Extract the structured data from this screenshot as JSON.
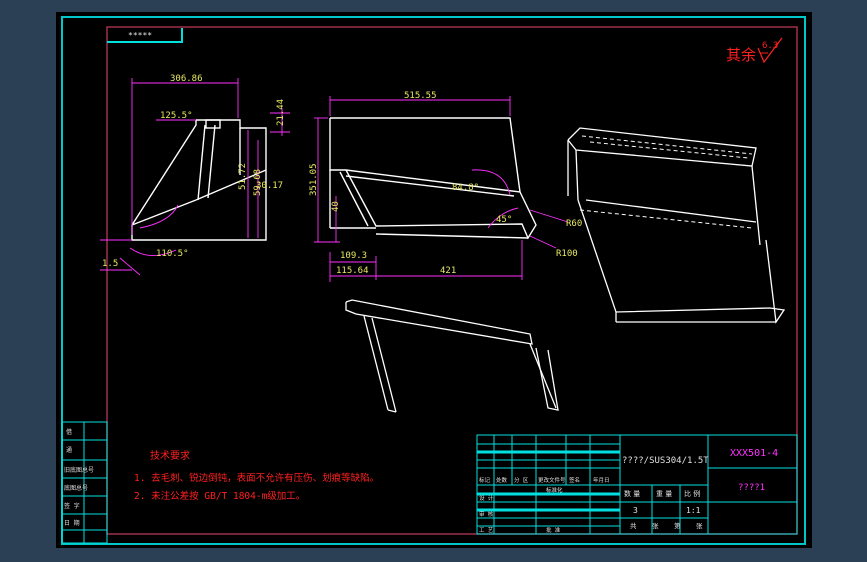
{
  "colors": {
    "background": "#2b3f55",
    "sheet": "#000000",
    "frame_outer": "#00c8c8",
    "frame_inner": "#a0304a",
    "geometry": "#ffffff",
    "dimension": "#ff30ff",
    "dimension_text": "#e8e860",
    "table_line": "#00e0e0",
    "notes_red": "#ff2020"
  },
  "corner_tag": "*****",
  "roughness": {
    "label": "其余",
    "value": "6.3"
  },
  "dimensions": {
    "view1_width": "306.86",
    "view1_angle_top": "125.5°",
    "view1_height_small": "21.44",
    "view1_height_a": "51.72",
    "view1_height_b": "59.68",
    "view1_height_c": "30.17",
    "view1_angle_bottom": "110.5°",
    "view1_offset": "1.5",
    "view2_width": "515.55",
    "view2_height": "351.05",
    "view2_angle_a": "84.8°",
    "view2_angle_b": "45°",
    "view2_radius_a": "R60",
    "view2_radius_b": "R100",
    "view2_height_small": "40",
    "view2_len_a": "109.3",
    "view2_len_b": "115.64",
    "view2_len_c": "421"
  },
  "notes": {
    "title": "技术要求",
    "line1": "1. 去毛刺、锐边倒钝，表面不允许有压伤、划痕等缺陷。",
    "line2": "2. 未注公差按 GB/T 1804-m级加工。"
  },
  "title_block": {
    "material": "????/SUS304/1.5T",
    "drawing_no": "XXX501-4",
    "part_name": "????1",
    "qty_label": "数  量",
    "weight_label": "重  量",
    "scale_label": "比  例",
    "qty_value": "3",
    "scale_value": "1:1",
    "sheet_cells": [
      "共",
      "张",
      "第",
      "张"
    ],
    "row_labels": [
      "标记",
      "处数",
      "分  区",
      "更改文件号",
      "签名",
      "年月日"
    ],
    "left_labels": [
      "设  计",
      "审  核",
      "工  艺"
    ],
    "std_label": "标准化",
    "approve_label": "批  准"
  },
  "side_strip": {
    "labels": [
      "借",
      "通",
      "旧底图总号",
      "底图总号",
      "签  字",
      "日  期"
    ]
  }
}
